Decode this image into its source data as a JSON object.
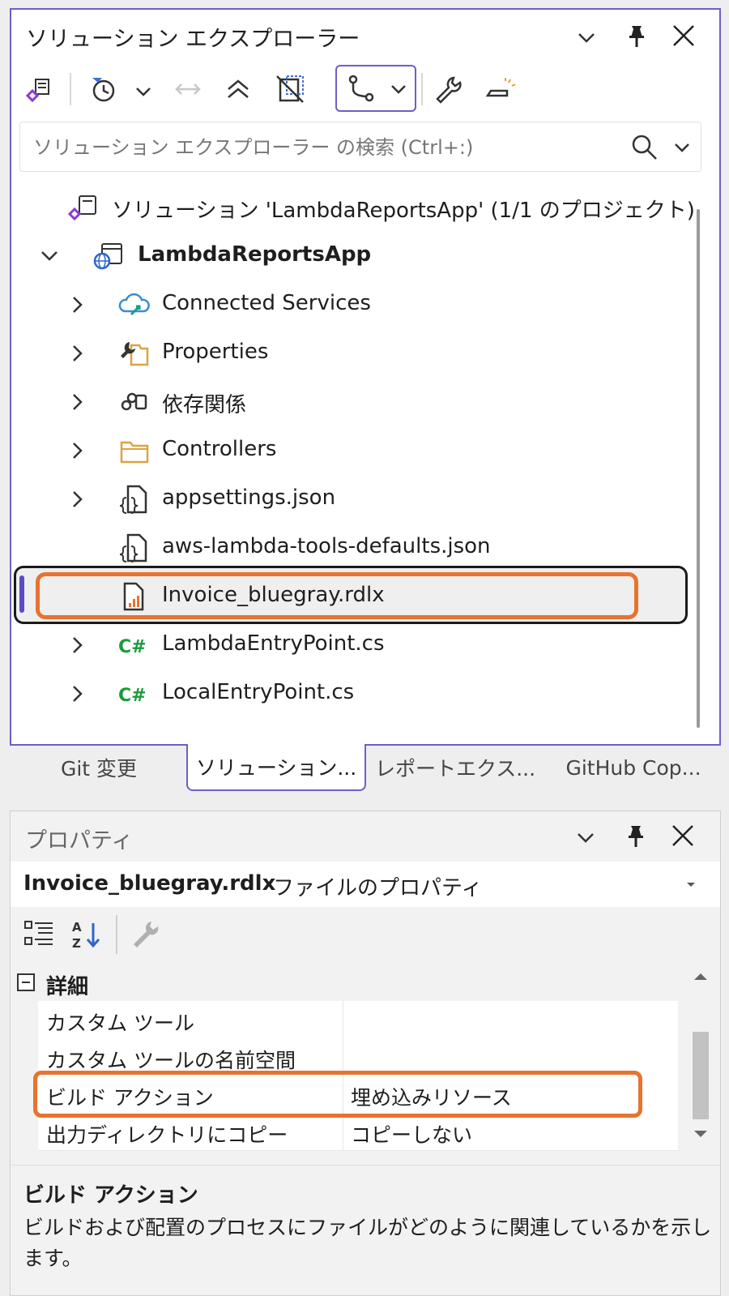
{
  "solution_explorer": {
    "title": "ソリューション エクスプローラー",
    "search_placeholder": "ソリューション エクスプローラー の検索 (Ctrl+:)",
    "tree": {
      "solution": "ソリューション 'LambdaReportsApp' (1/1 のプロジェクト)",
      "project": "LambdaReportsApp",
      "items": [
        {
          "label": "Connected Services",
          "icon": "connected-services-icon"
        },
        {
          "label": "Properties",
          "icon": "properties-icon"
        },
        {
          "label": "依存関係",
          "icon": "dependencies-icon"
        },
        {
          "label": "Controllers",
          "icon": "folder-icon"
        },
        {
          "label": "appsettings.json",
          "icon": "json-file-icon"
        },
        {
          "label": "aws-lambda-tools-defaults.json",
          "icon": "json-file-icon"
        },
        {
          "label": "Invoice_bluegray.rdlx",
          "icon": "report-file-icon"
        },
        {
          "label": "LambdaEntryPoint.cs",
          "icon": "csharp-file-icon"
        },
        {
          "label": "LocalEntryPoint.cs",
          "icon": "csharp-file-icon"
        }
      ]
    }
  },
  "tabs": [
    "Git 変更",
    "ソリューション...",
    "レポートエクス...",
    "GitHub Cop..."
  ],
  "properties": {
    "title": "プロパティ",
    "object_name": "Invoice_bluegray.rdlx",
    "object_type": "ファイルのプロパティ",
    "category": "詳細",
    "rows": [
      {
        "name": "カスタム ツール",
        "value": ""
      },
      {
        "name": "カスタム ツールの名前空間",
        "value": ""
      },
      {
        "name": "ビルド アクション",
        "value": "埋め込みリソース"
      },
      {
        "name": "出力ディレクトリにコピー",
        "value": "コピーしない"
      }
    ],
    "description_title": "ビルド アクション",
    "description_text": "ビルドおよび配置のプロセスにファイルがどのように関連しているかを示します。"
  },
  "colors": {
    "accent": "#6b5fc9",
    "highlight": "#e8732f",
    "csharp": "#1a9c3a"
  }
}
